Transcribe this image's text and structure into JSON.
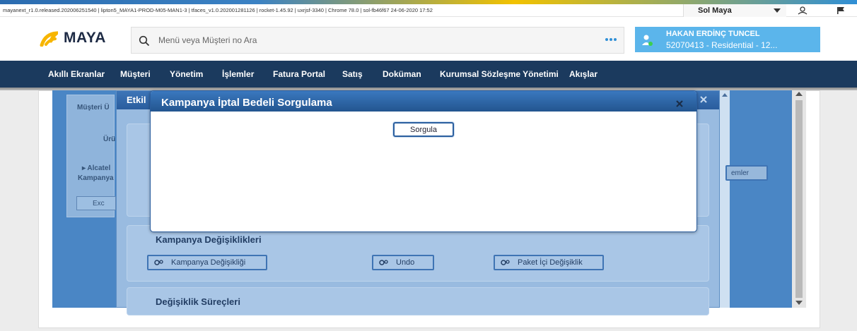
{
  "top_bar": {
    "version_text": "mayanext_r1.0.released.202006251540 | lipton5_MAYA1-PROD-M05-MAN1-3 | tfaces_v1.0.202001281126 | rocket-1.45.92 | uxrjsf-3340 | Chrome 78.0 | sol-fb46f67 24-06-2020 17:52",
    "sol_select": "Sol Maya"
  },
  "header": {
    "logo_text": "MAYA",
    "search_placeholder": "Menü veya Müşteri no Ara",
    "customer_name": "HAKAN ERDİNÇ TUNCEL",
    "customer_sub": "52070413 - Residential - 12..."
  },
  "nav": {
    "items": [
      "Akıllı Ekranlar",
      "Müşteri",
      "Yönetim",
      "İşlemler",
      "Fatura Portal",
      "Satış",
      "Doküman",
      "Kurumsal Sözleşme Yönetimi",
      "Akışlar"
    ]
  },
  "background": {
    "musteri_label": "Müşteri Ü",
    "urun_label": "Ürü",
    "alcatel_label": "▸ Alcatel",
    "kampanya_label": "Kampanya",
    "excel_label": "Exc",
    "right_btn_label": "emler"
  },
  "dialog2": {
    "title": "Etkil",
    "section1_title": "Kampanya Değişiklikleri",
    "section1_buttons": [
      "Kampanya Değişikliği",
      "Undo",
      "Paket İçi Değişiklik"
    ],
    "section2_title": "Değişiklik Süreçleri"
  },
  "dialog": {
    "title": "Kampanya İptal Bedeli Sorgulama",
    "sorgula_label": "Sorgula"
  },
  "colors": {
    "nav_bg": "#1b3a5e",
    "customer_bg": "#5bb5eb",
    "dialog_title_bg": "#23558f"
  }
}
